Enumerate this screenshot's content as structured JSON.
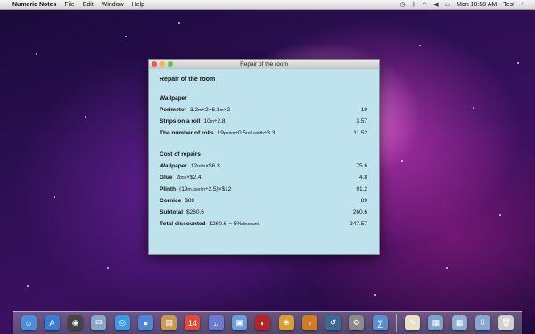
{
  "menubar": {
    "app_name": "Numeric Notes",
    "menus": [
      "File",
      "Edit",
      "Window",
      "Help"
    ],
    "clock": "Mon 10:58 AM",
    "user": "Test"
  },
  "window": {
    "title": "Repair of the room",
    "doc_title": "Repair of the room",
    "wallpaper": {
      "heading": "Wallpaper",
      "rows": [
        {
          "label": "Perimeter",
          "expr": [
            "3.2",
            "m",
            "×2+6.3",
            "m",
            "×2"
          ],
          "value": "19"
        },
        {
          "label": "Strips on a roll",
          "expr": [
            "10",
            "m",
            "÷2.8"
          ],
          "value": "3.57"
        },
        {
          "label": "The number of rolls",
          "expr": [
            "19",
            "perim",
            "÷0.5",
            "roll width",
            "÷3.3"
          ],
          "value": "11.52"
        }
      ]
    },
    "costs": {
      "heading": "Cost of repairs",
      "rows": [
        {
          "label": "Wallpaper",
          "expr": [
            "12",
            "rolls",
            "×$6.3"
          ],
          "value": "75.6"
        },
        {
          "label": "Glue",
          "expr": [
            "2",
            "box",
            "×$2.4"
          ],
          "value": "4.8"
        },
        {
          "label": "Plinth",
          "expr": [
            "(19",
            "m. perim",
            "÷2.5)×$12"
          ],
          "value": "91.2"
        },
        {
          "label": "Cornice",
          "expr": [
            "$89"
          ],
          "value": "89"
        },
        {
          "label": "Subtotal",
          "expr": [
            "$260.6"
          ],
          "value": "260.6"
        },
        {
          "label": "Total discounted",
          "expr": [
            "$260.6 − 5%",
            "discount"
          ],
          "value": "247.57"
        }
      ]
    }
  },
  "dock": {
    "icons": [
      "finder-icon",
      "app-store-icon",
      "dashboard-icon",
      "mail-icon",
      "safari-icon",
      "ichat-icon",
      "address-book-icon",
      "ical-icon",
      "itunes-icon",
      "preview-icon",
      "photo-booth-icon",
      "iphoto-icon",
      "garageband-icon",
      "time-machine-icon",
      "system-preferences-icon",
      "numeric-notes-icon",
      "textedit-icon",
      "applications-icon",
      "documents-icon",
      "downloads-icon",
      "trash-icon"
    ],
    "colors": [
      "#4a8fd8",
      "#3a7cd2",
      "#444",
      "#8aa6c8",
      "#3b9ae0",
      "#4e86d6",
      "#c99a55",
      "#e04b3a",
      "#6b7bd0",
      "#6aa0d8",
      "#b0262a",
      "#d8a035",
      "#cf7b28",
      "#3b6a93",
      "#8b8b8b",
      "#5b8fd0",
      "#e8e0c8",
      "#7ea3c9",
      "#8eb0d2",
      "#8aa8cf",
      "#d0d0d0"
    ],
    "glyphs": [
      "☺",
      "A",
      "◉",
      "✉",
      "◎",
      "●",
      "▤",
      "14",
      "♫",
      "▣",
      "◐",
      "❀",
      "♪",
      "↺",
      "⚙",
      "∑",
      "✎",
      "▦",
      "▦",
      "⇩",
      "🗑"
    ]
  }
}
